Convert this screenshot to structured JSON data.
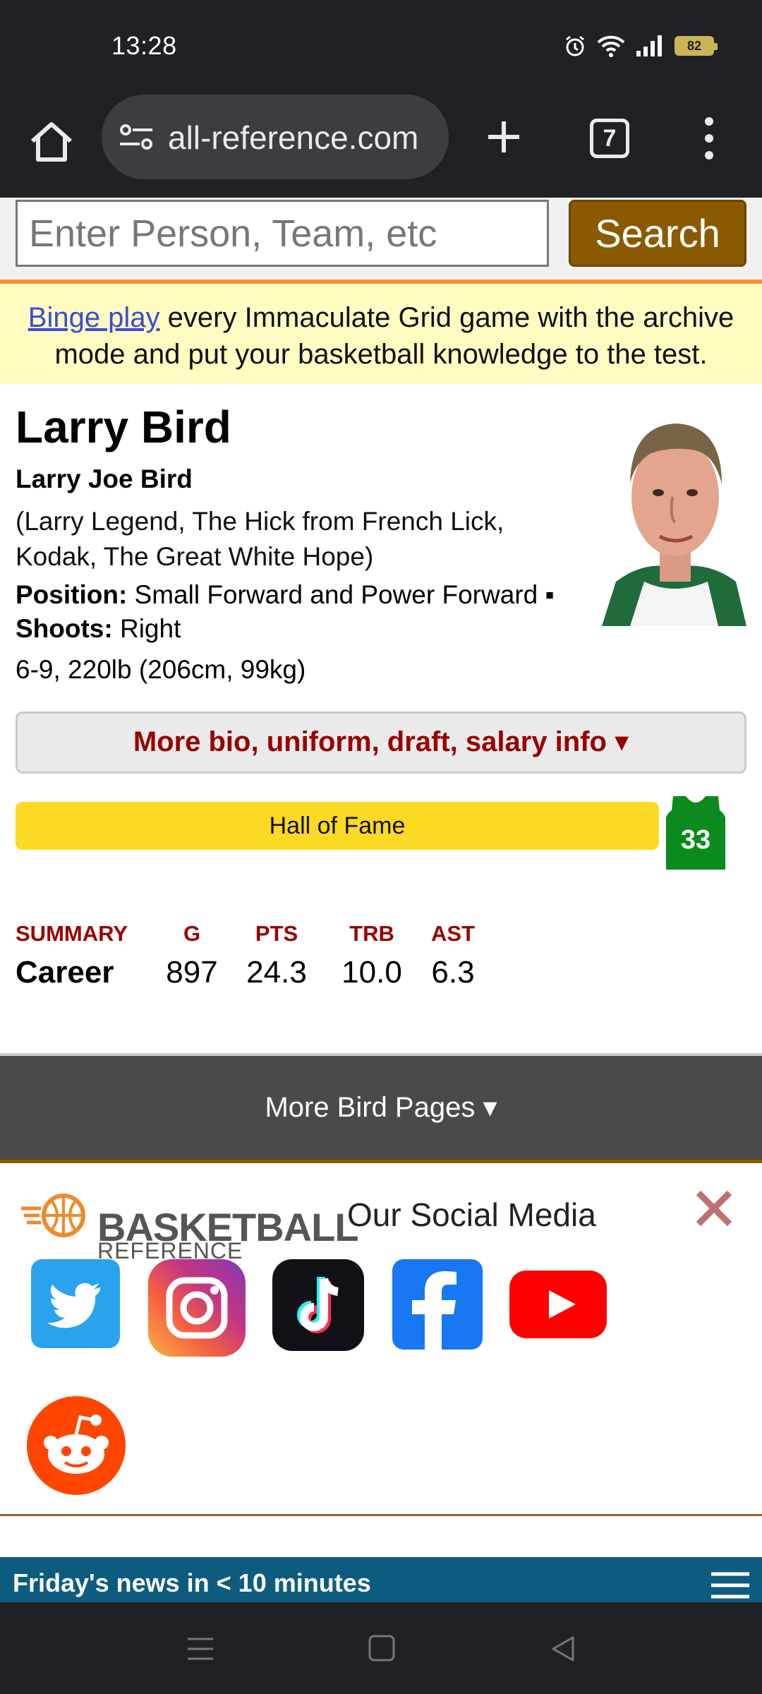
{
  "status_bar": {
    "time": "13:28",
    "battery": "82"
  },
  "browser": {
    "url": "all-reference.com",
    "tab_count": "7"
  },
  "search": {
    "placeholder": "Enter Person, Team, etc",
    "button_label": "Search"
  },
  "promo": {
    "link_text": "Binge play",
    "text": " every Immaculate Grid game with the archive mode and put your basketball knowledge to the test."
  },
  "player": {
    "name": "Larry Bird",
    "full_name": "Larry Joe Bird",
    "nicknames": "(Larry Legend, The Hick from French Lick, Kodak, The Great White Hope)",
    "position_label": "Position:",
    "position": " Small Forward and Power Forward ▪",
    "shoots_label": "Shoots:",
    "shoots": " Right",
    "measurements": "6-9, 220lb (206cm, 99kg)",
    "more_bio_label": "More bio, uniform, draft, salary info ▾",
    "hof_label": "Hall of Fame",
    "jersey_number": "33"
  },
  "summary": {
    "headers": [
      "SUMMARY",
      "G",
      "PTS",
      "TRB",
      "AST"
    ],
    "row": [
      "Career",
      "897",
      "24.3",
      "10.0",
      "6.3"
    ]
  },
  "more_pages_label": "More Bird Pages ▾",
  "social": {
    "logo_word1": "BASKETBALL",
    "logo_word2": "REFERENCE",
    "title": "Our Social Media",
    "networks": [
      "twitter",
      "instagram",
      "tiktok",
      "facebook",
      "youtube",
      "reddit"
    ]
  },
  "news_bar": {
    "text": "Friday's news in < 10 minutes"
  },
  "colors": {
    "brand_brown": "#8b5a00",
    "stat_red": "#990000",
    "hof_yellow": "#fcd922",
    "promo_bg": "#fffbc1"
  }
}
